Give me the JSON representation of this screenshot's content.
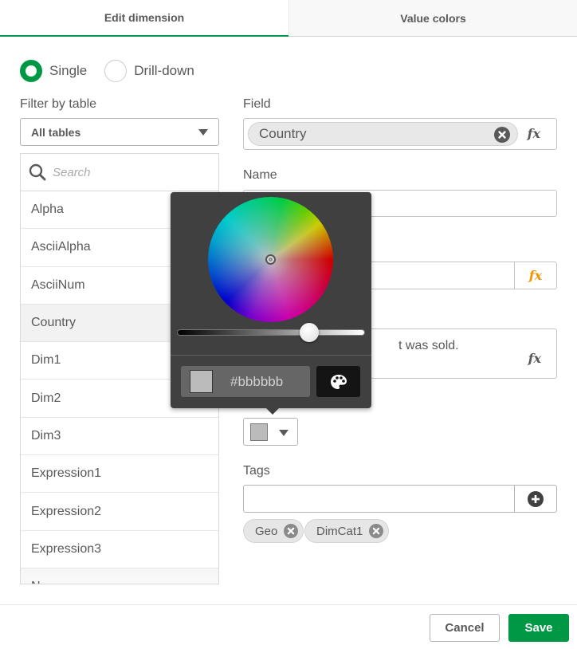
{
  "tabs": [
    {
      "label": "Edit dimension",
      "active": true
    },
    {
      "label": "Value colors",
      "active": false
    }
  ],
  "dimension_type": {
    "options": [
      {
        "label": "Single",
        "checked": true
      },
      {
        "label": "Drill-down",
        "checked": false
      }
    ]
  },
  "filter": {
    "label": "Filter by table",
    "selected": "All tables"
  },
  "field_list": {
    "search_placeholder": "Search",
    "items": [
      {
        "label": "Alpha",
        "selected": false
      },
      {
        "label": "AsciiAlpha",
        "selected": false
      },
      {
        "label": "AsciiNum",
        "selected": false
      },
      {
        "label": "Country",
        "selected": true
      },
      {
        "label": "Dim1",
        "selected": false
      },
      {
        "label": "Dim2",
        "selected": false
      },
      {
        "label": "Dim3",
        "selected": false
      },
      {
        "label": "Expression1",
        "selected": false
      },
      {
        "label": "Expression2",
        "selected": false
      },
      {
        "label": "Expression3",
        "selected": false
      },
      {
        "label": "N",
        "selected": false
      }
    ]
  },
  "form": {
    "field_label": "Field",
    "field_value": "Country",
    "name_label": "Name",
    "name_value": "",
    "label_expression_value": "",
    "description_visible_text": "t was sold.",
    "fx_label": "fx",
    "dimension_color_value": "#bbbbbb",
    "tags_label": "Tags",
    "tags_input_value": "",
    "tags": [
      "Geo",
      "DimCat1"
    ]
  },
  "color_picker": {
    "hex_value": "#bbbbbb",
    "swatch_color": "#bbbbbb",
    "lightness": 0.73
  },
  "footer": {
    "cancel_label": "Cancel",
    "save_label": "Save"
  },
  "colors": {
    "accent": "#009845",
    "fx_orange": "#f29300",
    "text": "#595959"
  }
}
